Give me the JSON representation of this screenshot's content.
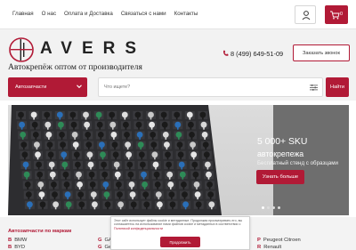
{
  "topnav": {
    "items": [
      "Главная",
      "О нас",
      "Оплата и Доставка",
      "Связаться с нами",
      "Контакты"
    ]
  },
  "cart": {
    "count": "0"
  },
  "logo": {
    "text": "AVERS"
  },
  "slogan": "Автокрепёж оптом от производителя",
  "phone": "8 (499) 649-51-09",
  "callback_label": "Заказать звонок",
  "catalog_label": "Автозапчасти",
  "search": {
    "placeholder": "Что ищете?"
  },
  "find_label": "Найти",
  "hero": {
    "title": "5 000+ SKU",
    "subtitle": "автокрепежа",
    "desc": "Бесплатный стенд с образцами",
    "button": "Узнать больше"
  },
  "brands": {
    "title": "Автозапчасти по маркам",
    "items": [
      {
        "mark": "B",
        "name": "BMW"
      },
      {
        "mark": "B",
        "name": "BYD"
      },
      {
        "mark": "G",
        "name": "GAZ"
      },
      {
        "mark": "G",
        "name": "Geely"
      },
      {
        "mark": "P",
        "name": "Peugeot Citroen"
      },
      {
        "mark": "R",
        "name": "Renault"
      }
    ]
  },
  "cookie": {
    "text": "Этот сайт использует файлы cookie и метаданные. Продолжая просматривать его, вы соглашаетесь на использование нами файлов cookie и метаданных в соответствии с",
    "link": "Политикой конфиденциальности",
    "button": "Продолжить"
  },
  "colors": {
    "accent": "#b11a36",
    "header_bg": "#f2f2f2",
    "panel": "#6e6e6e"
  },
  "icons": [
    "user-icon",
    "cart-icon",
    "phone-icon",
    "chevron-down-icon",
    "filter-icon"
  ]
}
